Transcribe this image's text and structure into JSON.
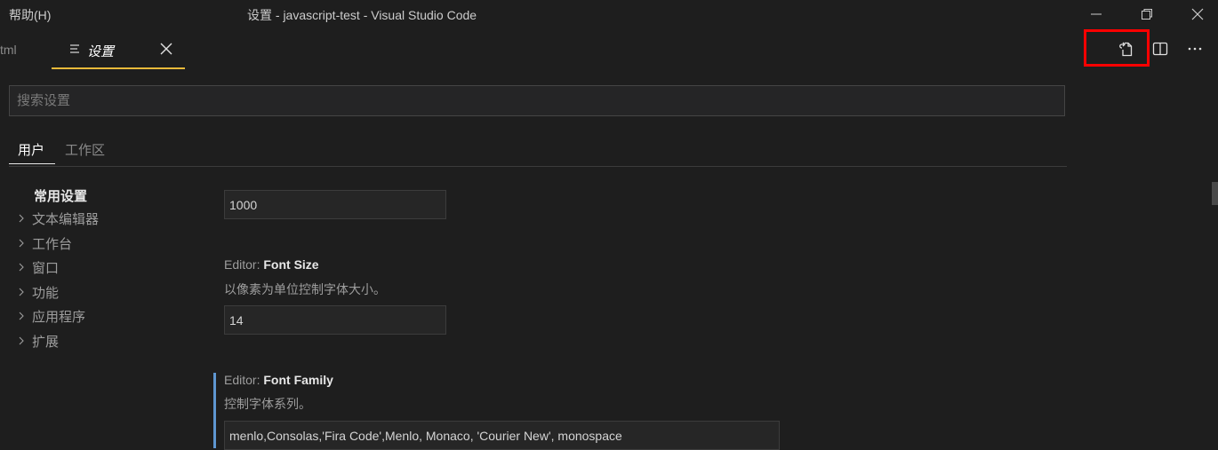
{
  "titlebar": {
    "menu_help": "帮助(H)",
    "window_title": "设置 - javascript-test - Visual Studio Code"
  },
  "tabs": {
    "prev_tab_label": "tml",
    "active_tab_label": "设置"
  },
  "search": {
    "placeholder": "搜索设置",
    "value": ""
  },
  "scope_tabs": {
    "user": "用户",
    "workspace": "工作区"
  },
  "toc": {
    "header": "常用设置",
    "items": [
      "文本编辑器",
      "工作台",
      "窗口",
      "功能",
      "应用程序",
      "扩展"
    ]
  },
  "settings": {
    "first_value": "1000",
    "font_size": {
      "category": "Editor: ",
      "name": "Font Size",
      "description": "以像素为单位控制字体大小。",
      "value": "14"
    },
    "font_family": {
      "category": "Editor: ",
      "name": "Font Family",
      "description": "控制字体系列。",
      "value": "menlo,Consolas,'Fira Code',Menlo, Monaco, 'Courier New', monospace"
    }
  },
  "colors": {
    "accent_tab": "#e8b93a",
    "highlight": "#ff0000",
    "modified": "#5e96d1"
  }
}
